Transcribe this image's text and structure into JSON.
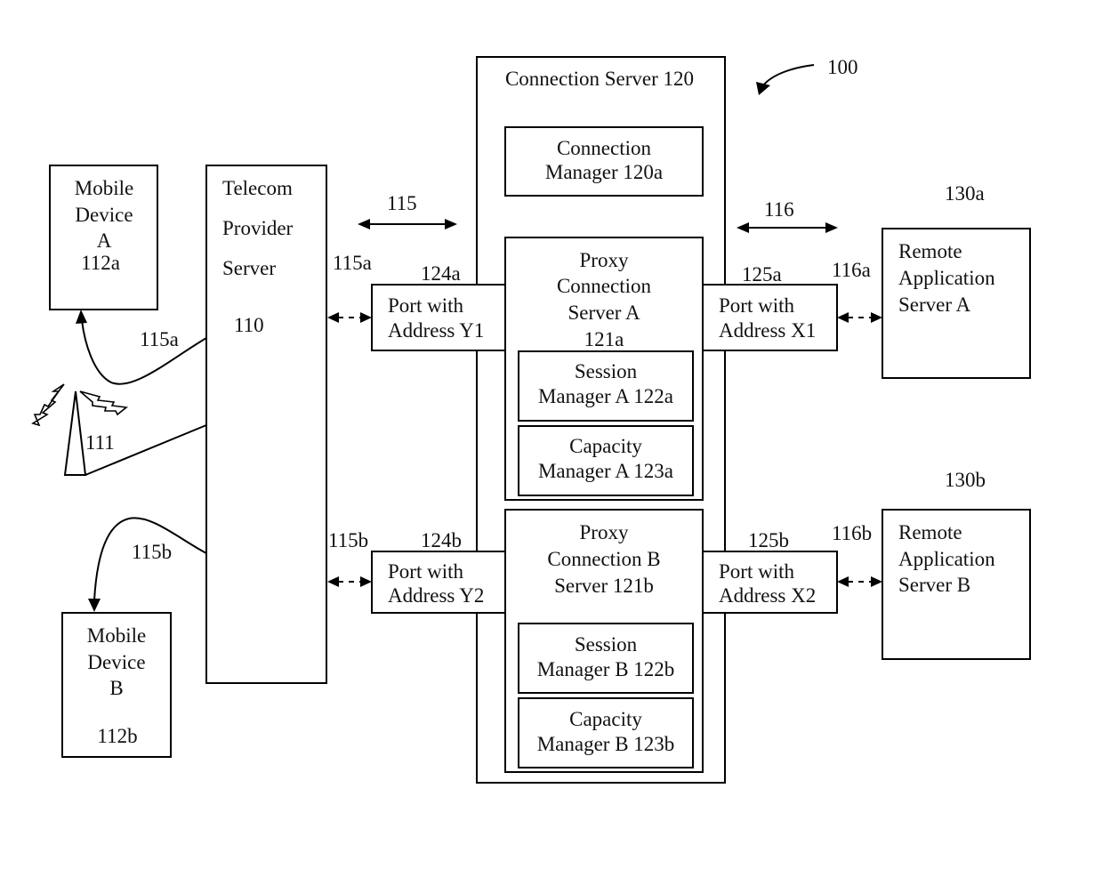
{
  "figure_ref": "100",
  "telecom": {
    "lines": [
      "Telecom",
      "Provider",
      "Server"
    ],
    "ref": "110"
  },
  "mobile_a": {
    "lines": [
      "Mobile",
      "Device",
      "A",
      "112a"
    ]
  },
  "mobile_b": {
    "lines": [
      "Mobile",
      "Device",
      "B",
      "112b"
    ]
  },
  "tower": {
    "ref": "111"
  },
  "links": {
    "l115": "115",
    "l116": "116",
    "l115a_left": "115a",
    "l115a_right": "115a",
    "l115b_left": "115b",
    "l115b_right": "115b",
    "l116a": "116a",
    "l116b": "116b",
    "l124a": "124a",
    "l124b": "124b",
    "l125a": "125a",
    "l125b": "125b"
  },
  "connection_server": {
    "title": "Connection Server 120",
    "manager": [
      "Connection",
      "Manager 120a"
    ],
    "proxy_a": {
      "lines": [
        "Proxy",
        "Connection",
        "Server A",
        "121a"
      ],
      "session": [
        "Session",
        "Manager A 122a"
      ],
      "capacity": [
        "Capacity",
        "Manager A 123a"
      ]
    },
    "proxy_b": {
      "lines": [
        "Proxy",
        "Connection B",
        "Server 121b"
      ],
      "session": [
        "Session",
        "Manager B 122b"
      ],
      "capacity": [
        "Capacity",
        "Manager B 123b"
      ]
    }
  },
  "ports": {
    "y1": [
      "Port with",
      "Address Y1"
    ],
    "y2": [
      "Port with",
      "Address Y2"
    ],
    "x1": [
      "Port with",
      "Address X1"
    ],
    "x2": [
      "Port with",
      "Address X2"
    ]
  },
  "remote_a": {
    "ref": "130a",
    "lines": [
      "Remote",
      "Application",
      "Server A"
    ]
  },
  "remote_b": {
    "ref": "130b",
    "lines": [
      "Remote",
      "Application",
      "Server B"
    ]
  }
}
